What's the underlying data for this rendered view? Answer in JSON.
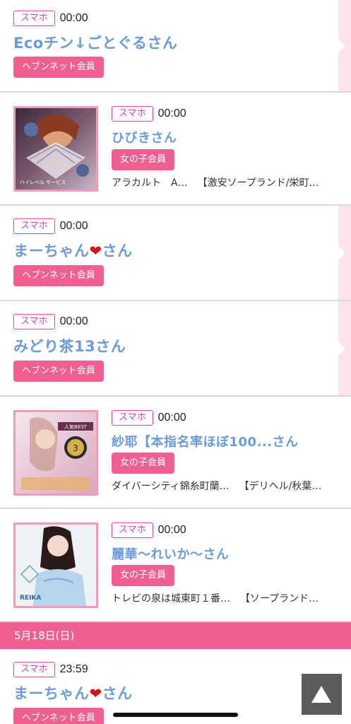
{
  "entries": [
    {
      "tag": "スマホ",
      "time": "00:00",
      "name": "Ecoチン↓ごとぐるさん",
      "badge": "ヘブンネット会員"
    },
    {
      "tag": "スマホ",
      "time": "00:00",
      "name": "ひびきさん",
      "badge": "女の子会員",
      "shop1": "アラカルト　A…",
      "shop2": "【激安ソープランド/栄町…",
      "thumb_text": "ハイレベル サービス"
    },
    {
      "tag": "スマホ",
      "time": "00:00",
      "name_pre": "まーちゃん",
      "heart": "❤",
      "name_post": "さん",
      "badge": "ヘブンネット会員"
    },
    {
      "tag": "スマホ",
      "time": "00:00",
      "name": "みどり茶13さん",
      "badge": "ヘブンネット会員"
    },
    {
      "tag": "スマホ",
      "time": "00:00",
      "name": "紗耶【本指名率ほぼ100...さん",
      "badge": "女の子会員",
      "shop1": "ダイバーシティ錦糸町蘭…",
      "shop2": "【デリヘル/秋葉…",
      "thumb_text": "人気BEST",
      "thumb_rank": "3"
    },
    {
      "tag": "スマホ",
      "time": "00:00",
      "name": "麗華〜れいか〜さん",
      "badge": "女の子会員",
      "shop1": "トレビの泉は城東町１番…",
      "shop2": "【ソープランド…",
      "thumb_text": "REIKA"
    }
  ],
  "date_header": "5月18日(日)",
  "last_entry": {
    "tag": "スマホ",
    "time": "23:59",
    "name_pre": "まーちゃん",
    "heart": "❤",
    "name_post": "さん",
    "badge": "ヘブンネット会員"
  },
  "icons": {
    "scroll_top": "up-triangle-icon"
  },
  "colors": {
    "accent": "#f0608f",
    "tag": "#e23fa6",
    "name": "#6b9bdc",
    "strip": "#fde3ea"
  }
}
